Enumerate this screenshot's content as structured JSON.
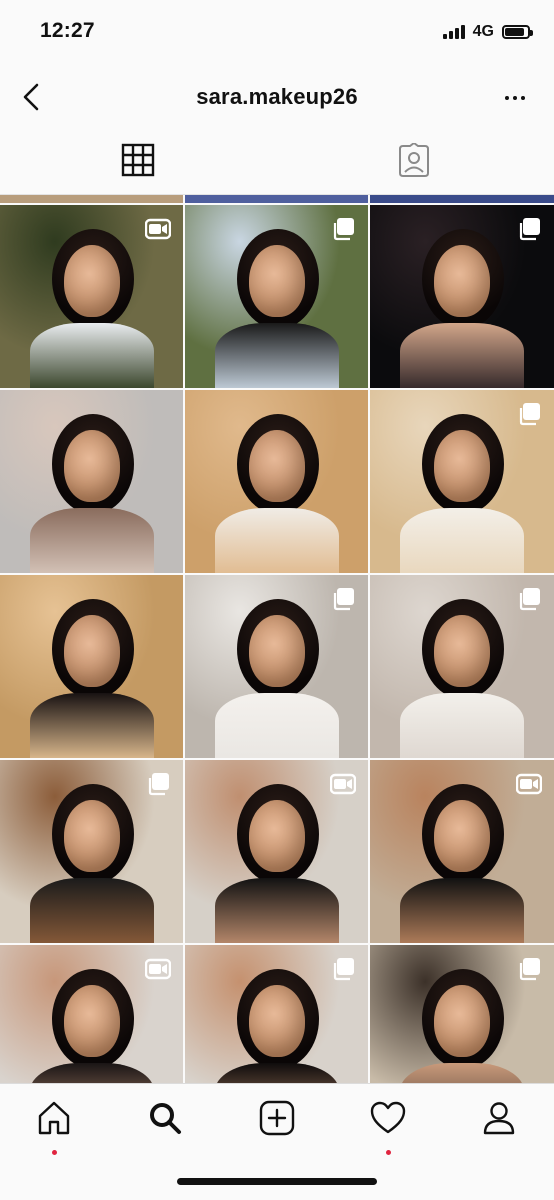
{
  "status_bar": {
    "time": "12:27",
    "network": "4G",
    "battery_level": 0.85
  },
  "header": {
    "title": "sara.makeup26",
    "back_icon": "chevron-left-icon",
    "more_icon": "more-horizontal-icon"
  },
  "tabs": [
    {
      "icon": "grid-icon",
      "active": true
    },
    {
      "icon": "tagged-user-icon",
      "active": false
    }
  ],
  "grid": {
    "tiles": [
      {
        "name": "post-1",
        "badge": "video-icon",
        "colors": [
          "#6e6a45",
          "#2f3b1f",
          "#e9ecef"
        ]
      },
      {
        "name": "post-2",
        "badge": "carousel-icon",
        "colors": [
          "#5f7041",
          "#c9d6e2",
          "#1a1a1a"
        ]
      },
      {
        "name": "post-3",
        "badge": "carousel-icon",
        "colors": [
          "#0b0b0d",
          "#2a2024",
          "#d2a68a"
        ]
      },
      {
        "name": "post-4",
        "badge": null,
        "colors": [
          "#bfbcba",
          "#d8c7bc",
          "#8a6c5d"
        ]
      },
      {
        "name": "post-5",
        "badge": null,
        "colors": [
          "#cda06a",
          "#e0b98c",
          "#f0ece6"
        ]
      },
      {
        "name": "post-6",
        "badge": "carousel-icon",
        "colors": [
          "#d7b98d",
          "#e8d6bb",
          "#f3efe8"
        ]
      },
      {
        "name": "post-7",
        "badge": null,
        "colors": [
          "#c49a63",
          "#e6c294",
          "#181212"
        ]
      },
      {
        "name": "post-8",
        "badge": "carousel-icon",
        "colors": [
          "#bdb6ae",
          "#e9e6e2",
          "#f4f1ed"
        ]
      },
      {
        "name": "post-9",
        "badge": "carousel-icon",
        "colors": [
          "#c2b7ad",
          "#ddd6cf",
          "#f3f0eb"
        ]
      },
      {
        "name": "post-10",
        "badge": "carousel-icon",
        "colors": [
          "#d7cdbf",
          "#8c5d3a",
          "#1b1b1b"
        ]
      },
      {
        "name": "post-11",
        "badge": "video-icon",
        "colors": [
          "#d6d0c8",
          "#c08f70",
          "#121212"
        ]
      },
      {
        "name": "post-12",
        "badge": "video-icon",
        "colors": [
          "#c1ad96",
          "#b9835e",
          "#111111"
        ]
      },
      {
        "name": "post-13",
        "badge": "video-icon",
        "colors": [
          "#d9d3cd",
          "#c7977a",
          "#1a1515"
        ]
      },
      {
        "name": "post-14",
        "badge": "carousel-icon",
        "colors": [
          "#d8d2cb",
          "#c5916f",
          "#0f0c0c"
        ]
      },
      {
        "name": "post-15",
        "badge": "carousel-icon",
        "colors": [
          "#c8bba8",
          "#3c3129",
          "#c99a7b"
        ]
      }
    ]
  },
  "bottom_nav": [
    {
      "icon": "home-icon",
      "dot": true
    },
    {
      "icon": "search-icon",
      "dot": false
    },
    {
      "icon": "add-post-icon",
      "dot": false
    },
    {
      "icon": "activity-heart-icon",
      "dot": true
    },
    {
      "icon": "profile-icon",
      "dot": false
    }
  ]
}
